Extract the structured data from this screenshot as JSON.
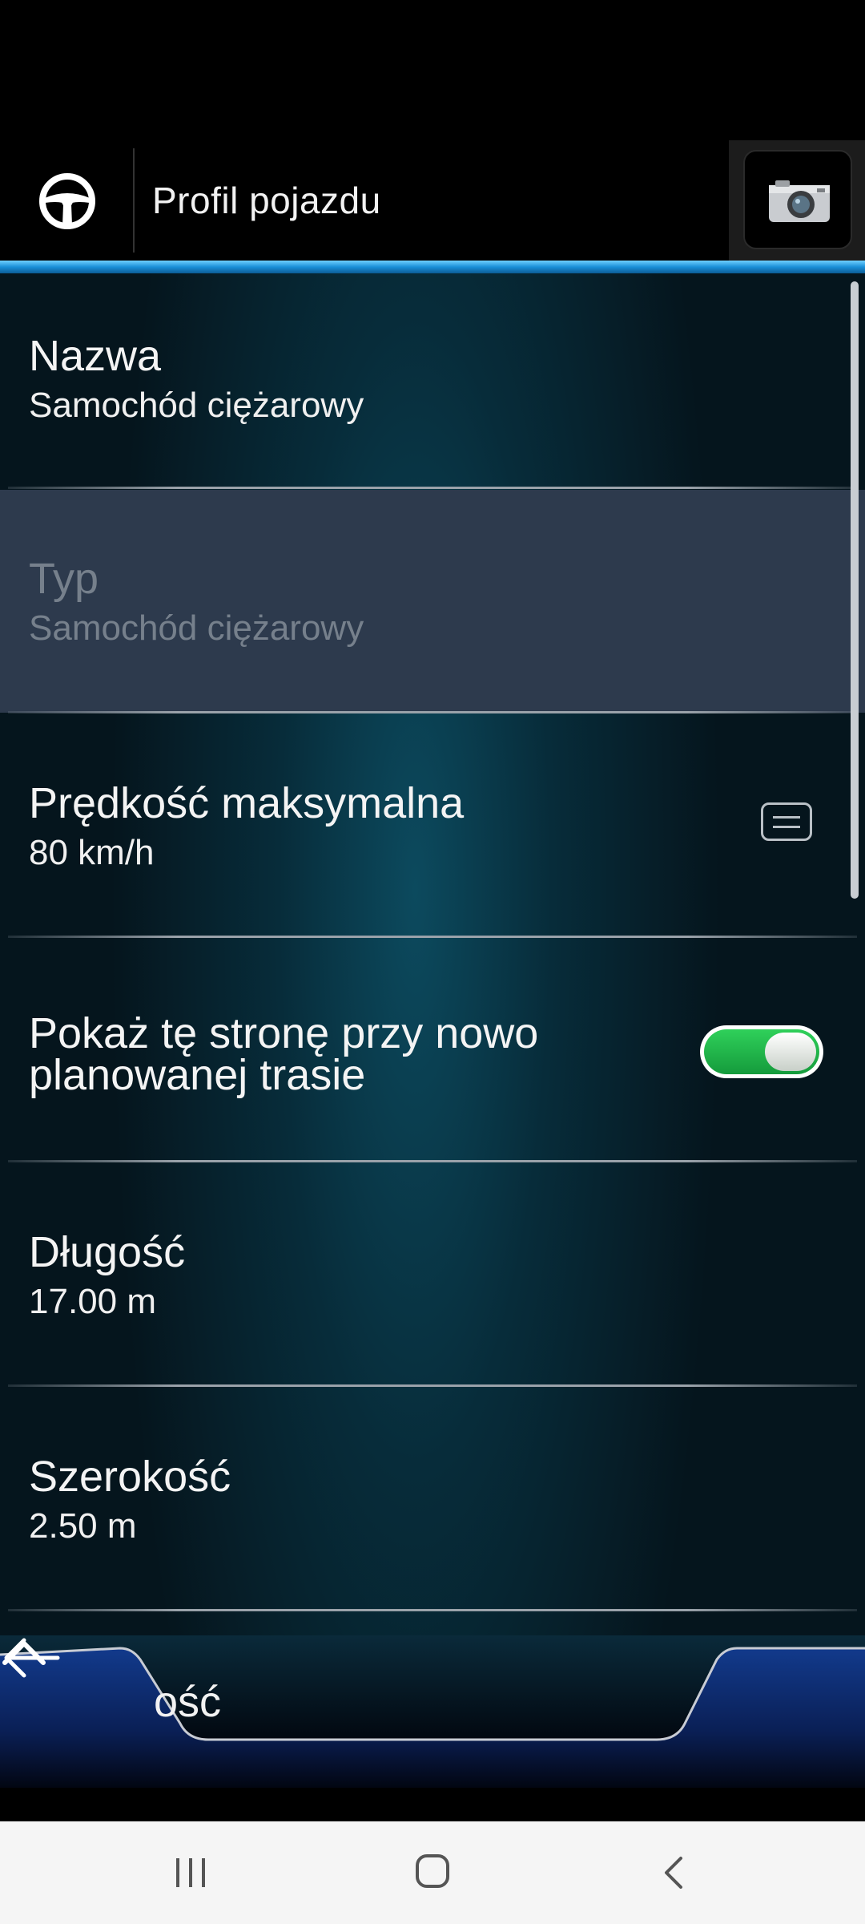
{
  "header": {
    "title": "Profil pojazdu"
  },
  "rows": [
    {
      "label": "Nazwa",
      "value": "Samochód ciężarowy"
    },
    {
      "label": "Typ",
      "value": "Samochód ciężarowy"
    },
    {
      "label": "Prędkość maksymalna",
      "value": "80 km/h"
    },
    {
      "label": "Pokaż tę stronę przy nowo planowanej trasie",
      "toggle_on": true
    },
    {
      "label": "Długość",
      "value": "17.00 m"
    },
    {
      "label": "Szerokość",
      "value": "2.50 m"
    }
  ],
  "bottom": {
    "peek_text": "ość"
  },
  "colors": {
    "accent": "#1a8fd8",
    "toggle_on": "#22b84a",
    "disabled_row": "#2d3a4d"
  }
}
